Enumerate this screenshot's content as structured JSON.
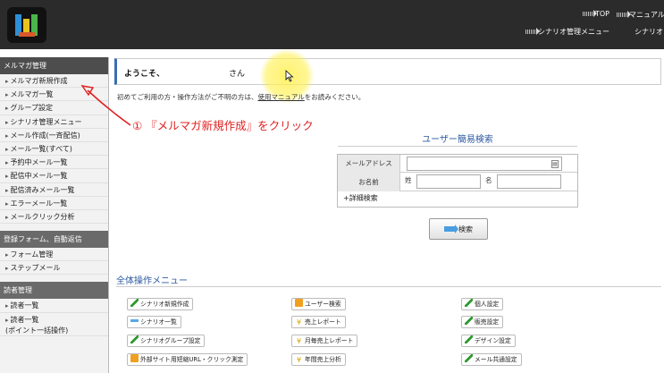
{
  "header": {
    "links": [
      "TOP",
      "マニュアル",
      "シナリオ管理メニュー",
      "シナリオ"
    ]
  },
  "sidebar": {
    "sections": [
      {
        "title": "メルマガ管理",
        "items": [
          "メルマガ新規作成",
          "メルマガ一覧",
          "グループ設定",
          "シナリオ管理メニュー",
          "メール作成(一斉配信)",
          "メール一覧(すべて)",
          "予約中メール一覧",
          "配信中メール一覧",
          "配信済みメール一覧",
          "エラーメール一覧",
          "メールクリック分析"
        ]
      },
      {
        "title": "登録フォーム、自動返信",
        "items": [
          "フォーム管理",
          "ステップメール"
        ]
      },
      {
        "title": "読者管理",
        "items": [
          "読者一覧",
          "読者一覧\n(ポイント一括操作)"
        ]
      }
    ]
  },
  "main": {
    "welcome": "ようこそ、",
    "san": "さん",
    "intro_before": "初めてご利用の方・操作方法がご不明の方は、",
    "intro_link": "使用マニュアル",
    "intro_after": "をお読みください。",
    "search": {
      "title": "ユーザー簡易検索",
      "email_label": "メールアドレス",
      "name_label": "お名前",
      "last_label": "姓",
      "first_label": "名",
      "detail": "+詳細検索",
      "button": "検索"
    },
    "menu_title": "全体操作メニュー",
    "menu_buttons": [
      {
        "label": "シナリオ新規作成",
        "icon": "pencil-icon"
      },
      {
        "label": "ユーザー検索",
        "icon": "folder-icon"
      },
      {
        "label": "個人設定",
        "icon": "pencil-icon"
      },
      {
        "label": "シナリオ一覧",
        "icon": "arrow-icon"
      },
      {
        "label": "売上レポート",
        "icon": "yen-icon"
      },
      {
        "label": "販売設定",
        "icon": "pencil-icon"
      },
      {
        "label": "シナリオグループ設定",
        "icon": "pencil-icon"
      },
      {
        "label": "月毎売上レポート",
        "icon": "yen-icon"
      },
      {
        "label": "デザイン設定",
        "icon": "pencil-icon"
      },
      {
        "label": "外部サイト用短縮URL・クリック測定",
        "icon": "folder-icon"
      },
      {
        "label": "年間売上分析",
        "icon": "yen-icon"
      },
      {
        "label": "メール共通設定",
        "icon": "pencil-icon"
      }
    ]
  },
  "annotation": {
    "text": "① 『メルマガ新規作成』をクリック",
    "color": "#e02020"
  }
}
